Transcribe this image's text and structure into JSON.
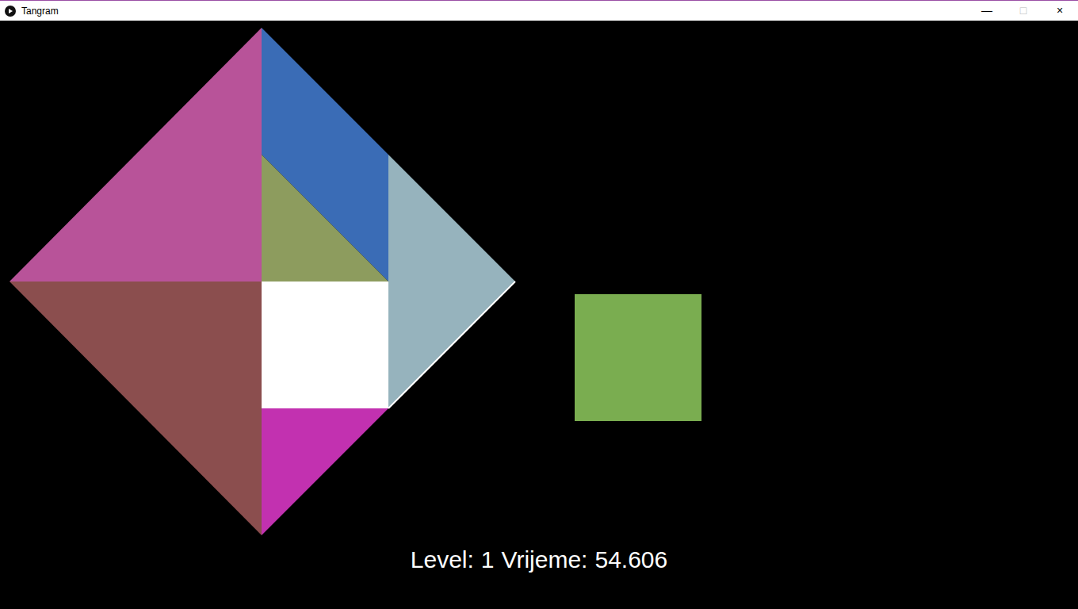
{
  "window": {
    "title": "Tangram",
    "controls": [
      "—",
      "□",
      "×"
    ]
  },
  "board": {
    "pieces": [
      {
        "kind": "large-triangle",
        "color": "#b85399"
      },
      {
        "kind": "large-triangle",
        "color": "#8b4e4e"
      },
      {
        "kind": "parallelogram",
        "color": "#3a6cb6"
      },
      {
        "kind": "small-triangle",
        "color": "#8d9c5e"
      },
      {
        "kind": "medium-triangle",
        "color": "#96b3bd"
      },
      {
        "kind": "square",
        "color": "#ffffff"
      },
      {
        "kind": "small-triangle",
        "color": "#c231b0"
      }
    ]
  },
  "loose_pieces": [
    {
      "kind": "square",
      "color": "#7aad50"
    }
  ],
  "hud": {
    "level_label": "Level:",
    "level": "1",
    "time_label": "Vrijeme:",
    "time": "54.606"
  }
}
